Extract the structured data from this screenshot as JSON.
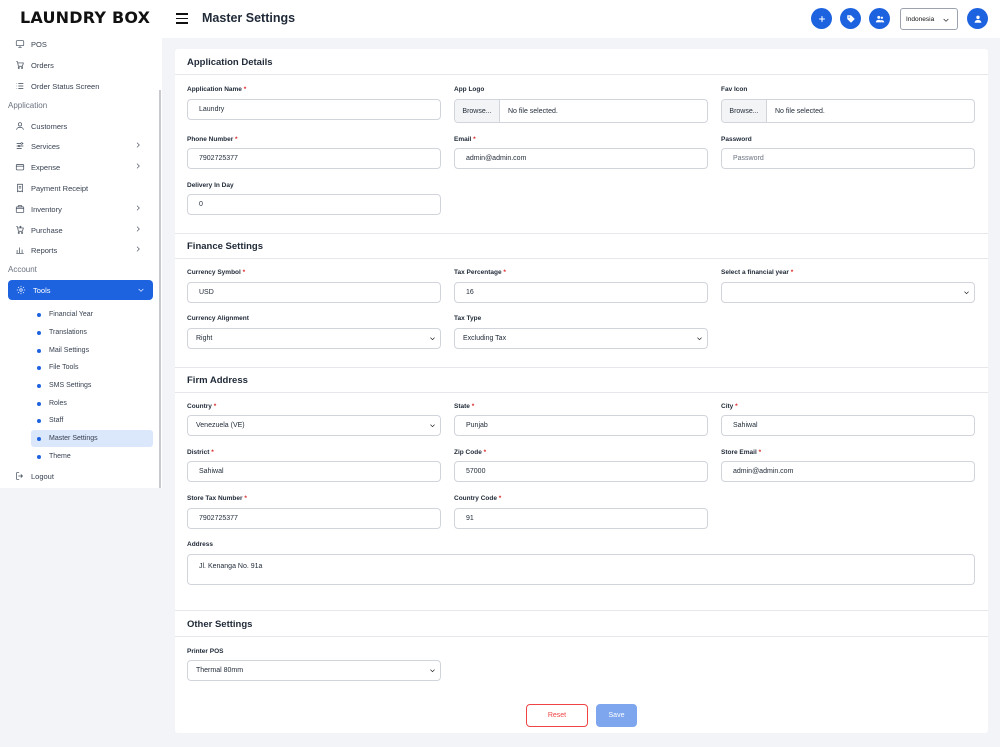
{
  "app": {
    "logo": "LAUNDRY BOX"
  },
  "header": {
    "title": "Master Settings",
    "language": "Indonesia"
  },
  "sidebar": {
    "top_items": [
      {
        "label": "POS"
      },
      {
        "label": "Orders"
      },
      {
        "label": "Order Status Screen"
      }
    ],
    "application_title": "Application",
    "application_items": [
      {
        "label": "Customers"
      },
      {
        "label": "Services"
      },
      {
        "label": "Expense"
      },
      {
        "label": "Payment Receipt"
      },
      {
        "label": "Inventory"
      },
      {
        "label": "Purchase"
      },
      {
        "label": "Reports"
      }
    ],
    "account_title": "Account",
    "tools_label": "Tools",
    "tools_sub": [
      {
        "label": "Financial Year"
      },
      {
        "label": "Translations"
      },
      {
        "label": "Mail Settings"
      },
      {
        "label": "File Tools"
      },
      {
        "label": "SMS Settings"
      },
      {
        "label": "Roles"
      },
      {
        "label": "Staff"
      },
      {
        "label": "Master Settings"
      },
      {
        "label": "Theme"
      }
    ],
    "logout_label": "Logout"
  },
  "application_details": {
    "title": "Application Details",
    "app_name_label": "Application Name",
    "app_name_value": "Laundry",
    "app_logo_label": "App Logo",
    "fav_icon_label": "Fav Icon",
    "browse_label": "Browse...",
    "no_file": "No file selected.",
    "phone_label": "Phone Number",
    "phone_value": "7902725377",
    "email_label": "Email",
    "email_value": "admin@admin.com",
    "password_label": "Password",
    "password_placeholder": "Password",
    "delivery_label": "Delivery In Day",
    "delivery_value": "0"
  },
  "finance_settings": {
    "title": "Finance Settings",
    "currency_symbol_label": "Currency Symbol",
    "currency_symbol_value": "USD",
    "tax_percentage_label": "Tax Percentage",
    "tax_percentage_value": "16",
    "financial_year_label": "Select a financial year",
    "financial_year_value": "",
    "currency_alignment_label": "Currency Alignment",
    "currency_alignment_value": "Right",
    "tax_type_label": "Tax Type",
    "tax_type_value": "Excluding Tax"
  },
  "firm_address": {
    "title": "Firm Address",
    "country_label": "Country",
    "country_value": "Venezuela (VE)",
    "state_label": "State",
    "state_value": "Punjab",
    "city_label": "City",
    "city_value": "Sahiwal",
    "district_label": "District",
    "district_value": "Sahiwal",
    "zip_label": "Zip Code",
    "zip_value": "57000",
    "store_email_label": "Store Email",
    "store_email_value": "admin@admin.com",
    "store_tax_label": "Store Tax Number",
    "store_tax_value": "7902725377",
    "country_code_label": "Country Code",
    "country_code_value": "91",
    "address_label": "Address",
    "address_value": "Jl. Kenanga No. 91a"
  },
  "other_settings": {
    "title": "Other Settings",
    "printer_label": "Printer POS",
    "printer_value": "Thermal 80mm"
  },
  "actions": {
    "reset": "Reset",
    "save": "Save"
  },
  "colors": {
    "accent": "#1d63e0",
    "danger": "#ef4444",
    "save_disabled": "#7ea6ee"
  }
}
